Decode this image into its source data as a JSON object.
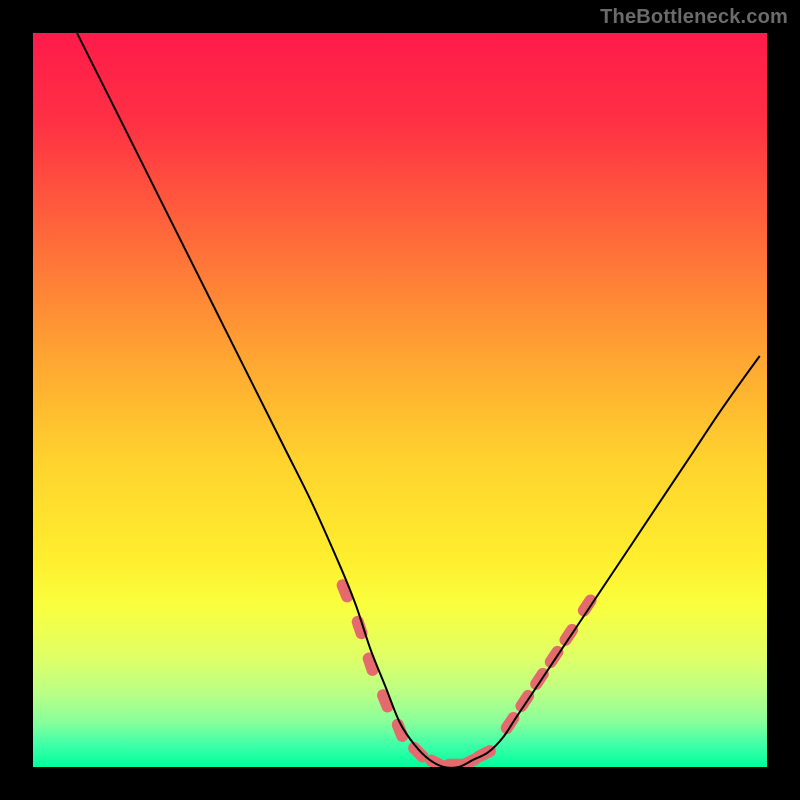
{
  "watermark": {
    "text": "TheBottleneck.com"
  },
  "colors": {
    "black": "#000000",
    "curve": "#000000",
    "marker": "#e46a6d",
    "gradient_stops": [
      {
        "pct": 0,
        "color": "#ff1b4a"
      },
      {
        "pct": 12,
        "color": "#ff3044"
      },
      {
        "pct": 28,
        "color": "#ff6a3a"
      },
      {
        "pct": 45,
        "color": "#ffa832"
      },
      {
        "pct": 58,
        "color": "#ffd22e"
      },
      {
        "pct": 72,
        "color": "#ffef2e"
      },
      {
        "pct": 78,
        "color": "#f9ff3e"
      },
      {
        "pct": 85,
        "color": "#e0ff66"
      },
      {
        "pct": 90,
        "color": "#b9ff86"
      },
      {
        "pct": 94,
        "color": "#86ff9c"
      },
      {
        "pct": 97,
        "color": "#3effa7"
      },
      {
        "pct": 100,
        "color": "#00ff9c"
      }
    ]
  },
  "chart_data": {
    "type": "line",
    "title": "",
    "xlabel": "",
    "ylabel": "",
    "xlim": [
      0,
      100
    ],
    "ylim": [
      0,
      100
    ],
    "grid": false,
    "legend": false,
    "series": [
      {
        "name": "bottleneck-curve",
        "x": [
          6,
          10,
          14,
          18,
          22,
          26,
          30,
          34,
          38,
          42,
          44,
          46,
          48,
          50,
          52,
          54,
          56,
          58,
          60,
          62,
          64,
          66,
          70,
          74,
          78,
          82,
          86,
          90,
          94,
          99
        ],
        "y": [
          100,
          92,
          84,
          76,
          68,
          60,
          52,
          44,
          36,
          27,
          22,
          16,
          11,
          6,
          3,
          1,
          0,
          0,
          1,
          2,
          4,
          7,
          13,
          19,
          25,
          31,
          37,
          43,
          49,
          56
        ]
      }
    ],
    "markers": {
      "name": "highlight-segments",
      "points": [
        {
          "x": 42.5,
          "y": 24
        },
        {
          "x": 44.5,
          "y": 19
        },
        {
          "x": 46.0,
          "y": 14
        },
        {
          "x": 48.0,
          "y": 9
        },
        {
          "x": 50.0,
          "y": 5
        },
        {
          "x": 52.5,
          "y": 2
        },
        {
          "x": 55.0,
          "y": 0.5
        },
        {
          "x": 57.5,
          "y": 0.3
        },
        {
          "x": 59.5,
          "y": 0.7
        },
        {
          "x": 61.5,
          "y": 1.8
        },
        {
          "x": 65.0,
          "y": 6
        },
        {
          "x": 67.0,
          "y": 9
        },
        {
          "x": 69.0,
          "y": 12
        },
        {
          "x": 71.0,
          "y": 15
        },
        {
          "x": 73.0,
          "y": 18
        },
        {
          "x": 75.5,
          "y": 22
        }
      ]
    }
  }
}
